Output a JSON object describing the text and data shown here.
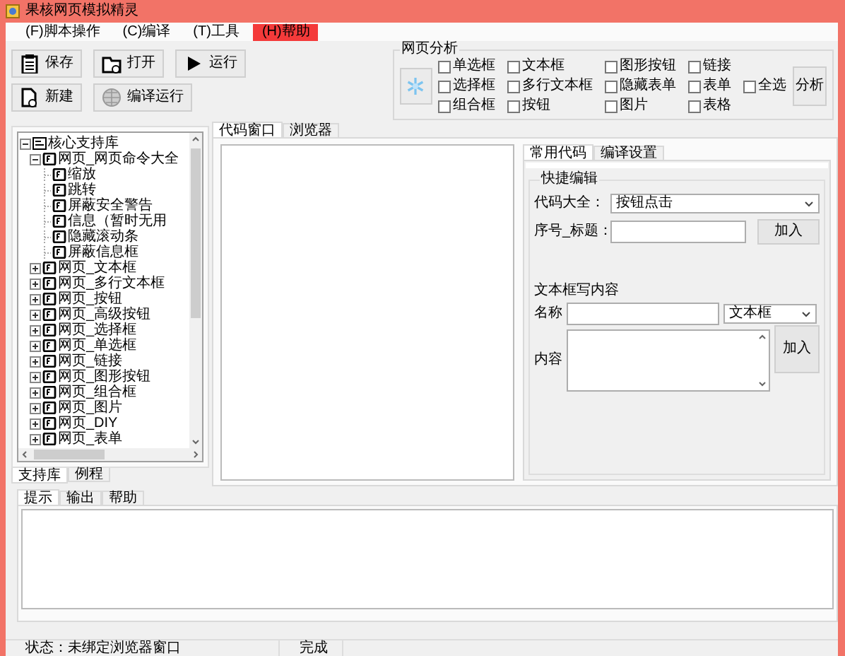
{
  "window": {
    "title": "果核网页模拟精灵"
  },
  "menu": [
    {
      "label": "(F)脚本操作",
      "selected": false
    },
    {
      "label": "(C)编译",
      "selected": false
    },
    {
      "label": "(T)工具",
      "selected": false
    },
    {
      "label": "(H)帮助",
      "selected": true
    }
  ],
  "toolbar": [
    [
      {
        "label": "保存",
        "kind": "save"
      },
      {
        "label": "打开",
        "kind": "open"
      },
      {
        "label": "运行",
        "kind": "run"
      }
    ],
    [
      {
        "label": "新建",
        "kind": "new"
      },
      {
        "label": "编译运行",
        "kind": "compile"
      }
    ]
  ],
  "analysis": {
    "title": "网页分析",
    "columns": [
      [
        {
          "label": "单选框",
          "checked": false
        },
        {
          "label": "选择框",
          "checked": false
        },
        {
          "label": "组合框",
          "checked": false
        }
      ],
      [
        {
          "label": "文本框",
          "checked": false
        },
        {
          "label": "多行文本框",
          "checked": false
        },
        {
          "label": "按钮",
          "checked": false
        }
      ],
      [
        {
          "label": "图形按钮",
          "checked": false
        },
        {
          "label": "隐藏表单",
          "checked": false
        },
        {
          "label": "图片",
          "checked": false
        }
      ],
      [
        {
          "label": "链接",
          "checked": false
        },
        {
          "label": "表单",
          "checked": false
        },
        {
          "label": "表格",
          "checked": false
        }
      ]
    ],
    "select_all": {
      "label": "全选",
      "checked": false
    },
    "analyze_button": "分析"
  },
  "library": {
    "tree": [
      {
        "label": "核心支持库",
        "expanded": true,
        "children": [
          {
            "label": "网页_网页命令大全",
            "expanded": true,
            "children": [
              {
                "label": "缩放"
              },
              {
                "label": "跳转"
              },
              {
                "label": "屏蔽安全警告"
              },
              {
                "label": "信息（暂时无用"
              },
              {
                "label": "隐藏滚动条"
              },
              {
                "label": "屏蔽信息框"
              }
            ]
          },
          {
            "label": "网页_文本框",
            "expanded": false
          },
          {
            "label": "网页_多行文本框",
            "expanded": false
          },
          {
            "label": "网页_按钮",
            "expanded": false
          },
          {
            "label": "网页_高级按钮",
            "expanded": false
          },
          {
            "label": "网页_选择框",
            "expanded": false
          },
          {
            "label": "网页_单选框",
            "expanded": false
          },
          {
            "label": "网页_链接",
            "expanded": false
          },
          {
            "label": "网页_图形按钮",
            "expanded": false
          },
          {
            "label": "网页_组合框",
            "expanded": false
          },
          {
            "label": "网页_图片",
            "expanded": false
          },
          {
            "label": "网页_DIY",
            "expanded": false
          },
          {
            "label": "网页_表单",
            "expanded": false
          }
        ]
      }
    ],
    "tabs": [
      {
        "label": "支持库",
        "selected": true
      },
      {
        "label": "例程",
        "selected": false
      }
    ]
  },
  "editor": {
    "tabs": [
      {
        "label": "代码窗口",
        "selected": true
      },
      {
        "label": "浏览器",
        "selected": false
      }
    ]
  },
  "code_panel": {
    "tabs": [
      {
        "label": "常用代码",
        "selected": true
      },
      {
        "label": "编译设置",
        "selected": false
      }
    ],
    "quick_edit": {
      "title": "快捷编辑",
      "code_label": "代码大全：",
      "code_value": "按钮点击",
      "title_label": "序号_标题：",
      "add_button": "加入"
    },
    "text_write": {
      "title": "文本框写内容",
      "name_label": "名称",
      "type_value": "文本框",
      "content_label": "内容",
      "add_button": "加入"
    }
  },
  "output": {
    "tabs": [
      {
        "label": "提示",
        "selected": true
      },
      {
        "label": "输出",
        "selected": false
      },
      {
        "label": "帮助",
        "selected": false
      }
    ]
  },
  "status_bar": [
    "状态：未绑定浏览器窗口",
    "完成"
  ]
}
